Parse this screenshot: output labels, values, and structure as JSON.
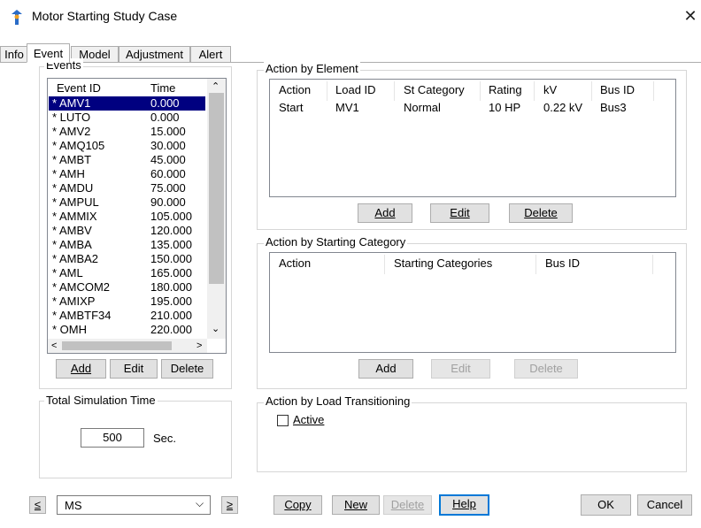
{
  "window": {
    "title": "Motor Starting Study Case",
    "close_glyph": "✕"
  },
  "tabs": [
    {
      "label": "Info"
    },
    {
      "label": "Event"
    },
    {
      "label": "Model"
    },
    {
      "label": "Adjustment"
    },
    {
      "label": "Alert"
    }
  ],
  "events": {
    "group_label": "Events",
    "columns": {
      "id": "Event ID",
      "time": "Time"
    },
    "rows": [
      {
        "id": "* AMV1",
        "time": "0.000"
      },
      {
        "id": "* LUTO",
        "time": "0.000"
      },
      {
        "id": "* AMV2",
        "time": "15.000"
      },
      {
        "id": "* AMQ105",
        "time": "30.000"
      },
      {
        "id": "* AMBT",
        "time": "45.000"
      },
      {
        "id": "* AMH",
        "time": "60.000"
      },
      {
        "id": "* AMDU",
        "time": "75.000"
      },
      {
        "id": "* AMPUL",
        "time": "90.000"
      },
      {
        "id": "* AMMIX",
        "time": "105.000"
      },
      {
        "id": "* AMBV",
        "time": "120.000"
      },
      {
        "id": "* AMBA",
        "time": "135.000"
      },
      {
        "id": "* AMBA2",
        "time": "150.000"
      },
      {
        "id": "* AML",
        "time": "165.000"
      },
      {
        "id": "* AMCOM2",
        "time": "180.000"
      },
      {
        "id": "* AMIXP",
        "time": "195.000"
      },
      {
        "id": "* AMBTF34",
        "time": "210.000"
      },
      {
        "id": "* OMH",
        "time": "220.000"
      }
    ],
    "buttons": {
      "add": "Add",
      "edit": "Edit",
      "delete": "Delete"
    }
  },
  "simulation": {
    "group_label": "Total Simulation Time",
    "value": "500",
    "unit": "Sec."
  },
  "action_by_element": {
    "group_label": "Action by Element",
    "columns": [
      "Action",
      "Load ID",
      "St Category",
      "Rating",
      "kV",
      "Bus ID"
    ],
    "rows": [
      [
        "Start",
        "MV1",
        "Normal",
        "10 HP",
        "0.22 kV",
        "Bus3"
      ]
    ],
    "buttons": {
      "add": "Add",
      "edit": "Edit",
      "delete": "Delete"
    }
  },
  "action_by_starting_category": {
    "group_label": "Action by Starting Category",
    "columns": [
      "Action",
      "Starting Categories",
      "Bus ID"
    ],
    "buttons": {
      "add": "Add",
      "edit": "Edit",
      "delete": "Delete"
    }
  },
  "action_by_load_transitioning": {
    "group_label": "Action by Load Transitioning",
    "checkbox_label": "Active",
    "checked": false
  },
  "footer": {
    "prev": "≤",
    "next": "≥",
    "case_select": "MS",
    "copy": "Copy",
    "new": "New",
    "delete": "Delete",
    "help": "Help",
    "ok": "OK",
    "cancel": "Cancel"
  },
  "colors": {
    "selection": "#000080",
    "focus": "#0078d7",
    "border": "#adadad",
    "disabled_text": "#a0a0a0"
  }
}
